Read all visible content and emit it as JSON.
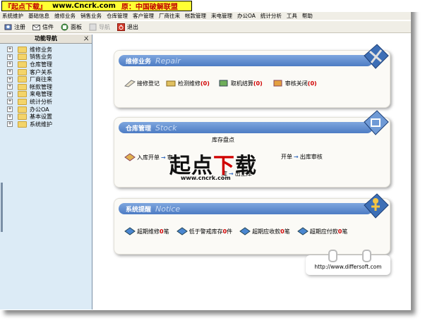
{
  "banner": {
    "site": "『起点下载』",
    "url": "www.Cncrk.com",
    "note": "原：中国破解联盟"
  },
  "menubar": [
    "系统维护",
    "基础信息",
    "维修业务",
    "销售业务",
    "仓库管理",
    "客户管理",
    "厂商往来",
    "帐款管理",
    "来电管理",
    "办公OA",
    "统计分析",
    "工具",
    "帮助"
  ],
  "toolbar": {
    "logout": "注册",
    "mail": "信件",
    "panel": "面板",
    "disabled": "导航",
    "exit": "退出"
  },
  "sidebar": {
    "title": "功能导航",
    "pin": "ㄨ",
    "items": [
      "维修业务",
      "销售业务",
      "仓库管理",
      "客户关系",
      "厂商往来",
      "帐款管理",
      "来电管理",
      "统计分析",
      "办公OA",
      "基本设置",
      "系统维护"
    ]
  },
  "repair": {
    "title": "维修业务",
    "title_en": "Repair",
    "items": [
      {
        "label": "接修登记",
        "count": ""
      },
      {
        "label": "检测维修",
        "count": "(0)"
      },
      {
        "label": "取机结算",
        "count": "(0)"
      },
      {
        "label": "审核关闭",
        "count": "(0)"
      }
    ]
  },
  "stock": {
    "title": "仓库管理",
    "title_en": "Stock",
    "top": "库存盘点",
    "in": "入库开单",
    "in2": "审",
    "out": "开单",
    "out_review": "出库审核",
    "bottom1": "库",
    "bottom2": "出上库"
  },
  "notice": {
    "title": "系统提醒",
    "title_en": "Notice",
    "items": [
      {
        "label": "超期维修",
        "count": "0",
        "unit": "笔"
      },
      {
        "label": "低于警戒库存",
        "count": "0",
        "unit": "件"
      },
      {
        "label": "超期应收款",
        "count": "0",
        "unit": "笔"
      },
      {
        "label": "超期应付款",
        "count": "0",
        "unit": "笔"
      }
    ]
  },
  "watermark": {
    "main_a": "起点",
    "main_b": "下",
    "main_c": "载",
    "url": "www.cncrk.com"
  },
  "footer_url": "http://www.differsoft.com"
}
